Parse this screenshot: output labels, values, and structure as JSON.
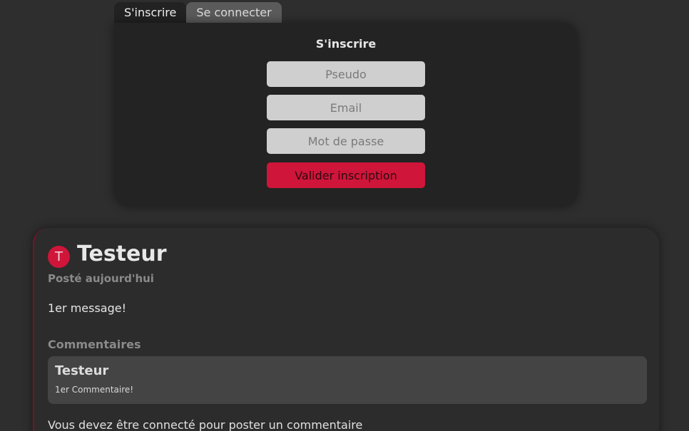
{
  "auth": {
    "tabs": [
      {
        "label": "S'inscrire",
        "active": true
      },
      {
        "label": "Se connecter",
        "active": false
      }
    ],
    "title": "S'inscrire",
    "fields": {
      "pseudo_placeholder": "Pseudo",
      "email_placeholder": "Email",
      "password_placeholder": "Mot de passe"
    },
    "submit_label": "Valider inscription"
  },
  "post": {
    "avatar_letter": "T",
    "author": "Testeur",
    "date": "Posté aujourd'hui",
    "body": "1er message!",
    "comments_heading": "Commentaires",
    "comments": [
      {
        "author": "Testeur",
        "text": "1er Commentaire!"
      }
    ],
    "login_note": "Vous devez être connecté pour poster un commentaire"
  },
  "colors": {
    "accent": "#d0153a",
    "background": "#2e2e2e",
    "card": "#232323",
    "input": "#cfcfcf"
  }
}
